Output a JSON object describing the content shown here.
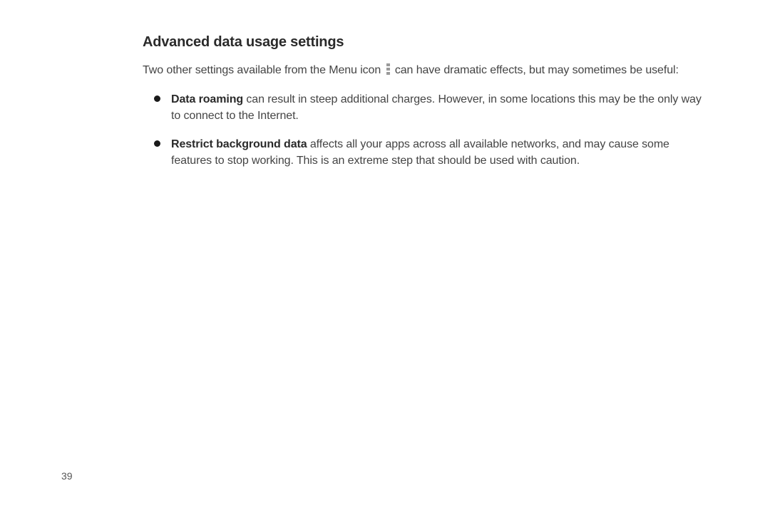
{
  "heading": "Advanced data usage settings",
  "intro_before": "Two other settings available from the Menu icon ",
  "intro_after": " can have dramatic effects, but may sometimes be useful:",
  "bullets": [
    {
      "bold": "Data roaming",
      "text": " can result in steep additional charges. However, in some locations this may be the only way to connect to the Internet."
    },
    {
      "bold": "Restrict background data",
      "text": " affects all your apps across all available networks, and may cause some features to stop working. This is an extreme step that should be used with caution."
    }
  ],
  "page_number": "39"
}
